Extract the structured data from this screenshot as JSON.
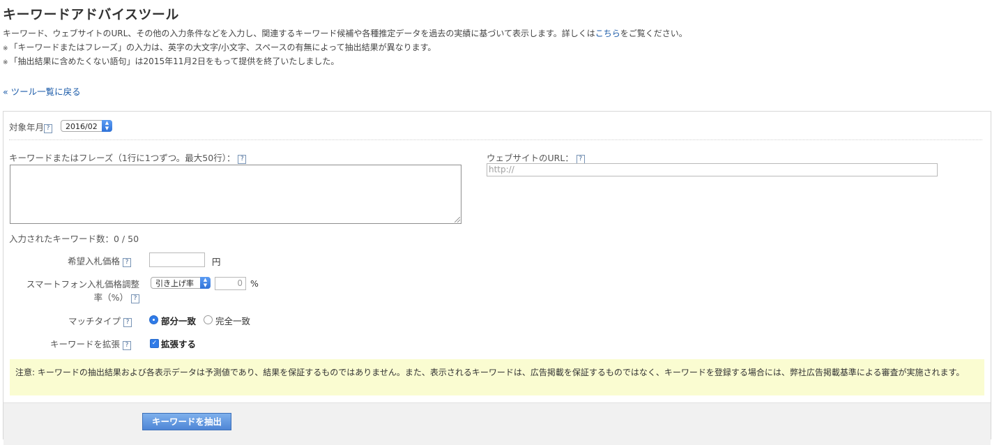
{
  "page": {
    "title": "キーワードアドバイスツール",
    "description_prefix": "キーワード、ウェブサイトのURL、その他の入力条件などを入力し、関連するキーワード候補や各種推定データを過去の実績に基づいて表示します。詳しくは",
    "description_link": "こちら",
    "description_suffix": "をご覧ください。",
    "note_mark": "※",
    "note1": "「キーワードまたはフレーズ」の入力は、英字の大文字/小文字、スペースの有無によって抽出結果が異なります。",
    "note2": "「抽出結果に含めたくない語句」は2015年11月2日をもって提供を終了いたしました。",
    "back_link": "« ツール一覧に戻る"
  },
  "form": {
    "help_glyph": "?",
    "target_month_label": "対象年月",
    "target_month_value": "2016/02",
    "keyword_label": "キーワードまたはフレーズ（1行に1つずつ。最大50行）：",
    "keyword_value": "",
    "url_label": "ウェブサイトのURL：",
    "url_placeholder": "http://",
    "keyword_count": "入力されたキーワード数：0 / 50",
    "bid_label": "希望入札価格",
    "bid_value": "",
    "bid_unit": "円",
    "smartphone_label_line1": "スマートフォン入札価格調整",
    "smartphone_label_line2": "率（%）",
    "smartphone_select_value": "引き上げ率",
    "smartphone_rate_value": "0",
    "smartphone_unit": "%",
    "match_type_label": "マッチタイプ",
    "match_partial": "部分一致",
    "match_exact": "完全一致",
    "match_selected": "部分一致",
    "expand_label": "キーワードを拡張",
    "expand_option": "拡張する",
    "expand_checked": true,
    "notice": "注意: キーワードの抽出結果および各表示データは予測値であり、結果を保証するものではありません。また、表示されるキーワードは、広告掲載を保証するものではなく、キーワードを登録する場合には、弊社広告掲載基準による審査が実施されます。",
    "submit_label": "キーワードを抽出"
  },
  "colors": {
    "link": "#1a5aa8",
    "accent": "#2f7be8",
    "notice_bg": "#fafcd1"
  }
}
